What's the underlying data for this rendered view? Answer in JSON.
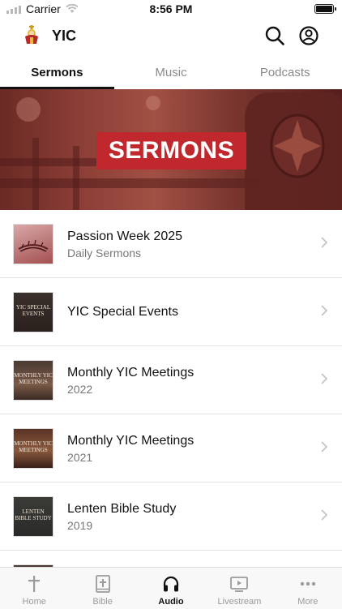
{
  "status_bar": {
    "carrier": "Carrier",
    "time": "8:56 PM"
  },
  "header": {
    "title": "YIC",
    "icons": [
      "search-icon",
      "profile-icon"
    ]
  },
  "tabs": [
    {
      "label": "Sermons",
      "active": true
    },
    {
      "label": "Music",
      "active": false
    },
    {
      "label": "Podcasts",
      "active": false
    }
  ],
  "banner": {
    "label": "SERMONS"
  },
  "items": [
    {
      "title": "Passion Week 2025",
      "subtitle": "Daily Sermons"
    },
    {
      "title": "YIC Special Events",
      "subtitle": "",
      "thumb_text": "YIC SPECIAL EVENTS"
    },
    {
      "title": "Monthly YIC Meetings",
      "subtitle": "2022",
      "thumb_text": "MONTHLY YIC MEETINGS"
    },
    {
      "title": "Monthly YIC Meetings",
      "subtitle": "2021",
      "thumb_text": "MONTHLY YIC MEETINGS"
    },
    {
      "title": "Lenten Bible Study",
      "subtitle": "2019",
      "thumb_text": "LENTEN BIBLE STUDY"
    }
  ],
  "tabbar": [
    {
      "label": "Home",
      "icon": "cross-icon",
      "active": false
    },
    {
      "label": "Bible",
      "icon": "bible-icon",
      "active": false
    },
    {
      "label": "Audio",
      "icon": "headphones-icon",
      "active": true
    },
    {
      "label": "Livestream",
      "icon": "tv-icon",
      "active": false
    },
    {
      "label": "More",
      "icon": "more-icon",
      "active": false
    }
  ],
  "colors": {
    "accent": "#111111",
    "banner_badge": "#c0282d",
    "inactive": "#9a9a9a"
  }
}
